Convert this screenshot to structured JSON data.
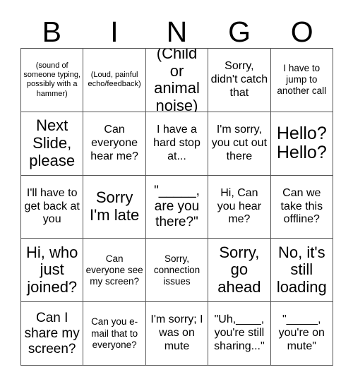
{
  "title": "BINGO",
  "header": {
    "letters": [
      "B",
      "I",
      "N",
      "G",
      "O"
    ]
  },
  "grid": {
    "columns": 5,
    "rows": 5,
    "border_color": "#555555",
    "background_color": "#ffffff",
    "text_color": "#000000",
    "cells": [
      {
        "text": "(sound of someone typing, possibly with a hammer)",
        "size": "xs"
      },
      {
        "text": "(Loud, painful echo/feedback)",
        "size": "xs"
      },
      {
        "text": "(Child or animal noise)",
        "size": "xl"
      },
      {
        "text": "Sorry, didn't catch that",
        "size": "m"
      },
      {
        "text": "I have to jump to another call",
        "size": "s"
      },
      {
        "text": "Next Slide, please",
        "size": "xl"
      },
      {
        "text": "Can everyone hear me?",
        "size": "m"
      },
      {
        "text": "I have a hard stop at...",
        "size": "m"
      },
      {
        "text": "I'm sorry, you cut out there",
        "size": "m"
      },
      {
        "text": "Hello? Hello?",
        "size": "xxl"
      },
      {
        "text": "I'll have to get back at you",
        "size": "m"
      },
      {
        "text": "Sorry I'm late",
        "size": "xl"
      },
      {
        "text": "\"_____, are you there?\"",
        "size": "l"
      },
      {
        "text": "Hi, Can you hear me?",
        "size": "m"
      },
      {
        "text": "Can we take this offline?",
        "size": "m"
      },
      {
        "text": "Hi, who just joined?",
        "size": "xl"
      },
      {
        "text": "Can everyone see my screen?",
        "size": "s"
      },
      {
        "text": "Sorry, connection issues",
        "size": "s"
      },
      {
        "text": "Sorry, go ahead",
        "size": "xl"
      },
      {
        "text": "No, it's still loading",
        "size": "xl"
      },
      {
        "text": "Can I share my screen?",
        "size": "l"
      },
      {
        "text": "Can you e-mail that to everyone?",
        "size": "s"
      },
      {
        "text": "I'm sorry; I was on mute",
        "size": "m"
      },
      {
        "text": "\"Uh,____, you're still sharing...\"",
        "size": "m"
      },
      {
        "text": "\"_____, you're on mute\"",
        "size": "m"
      }
    ]
  }
}
